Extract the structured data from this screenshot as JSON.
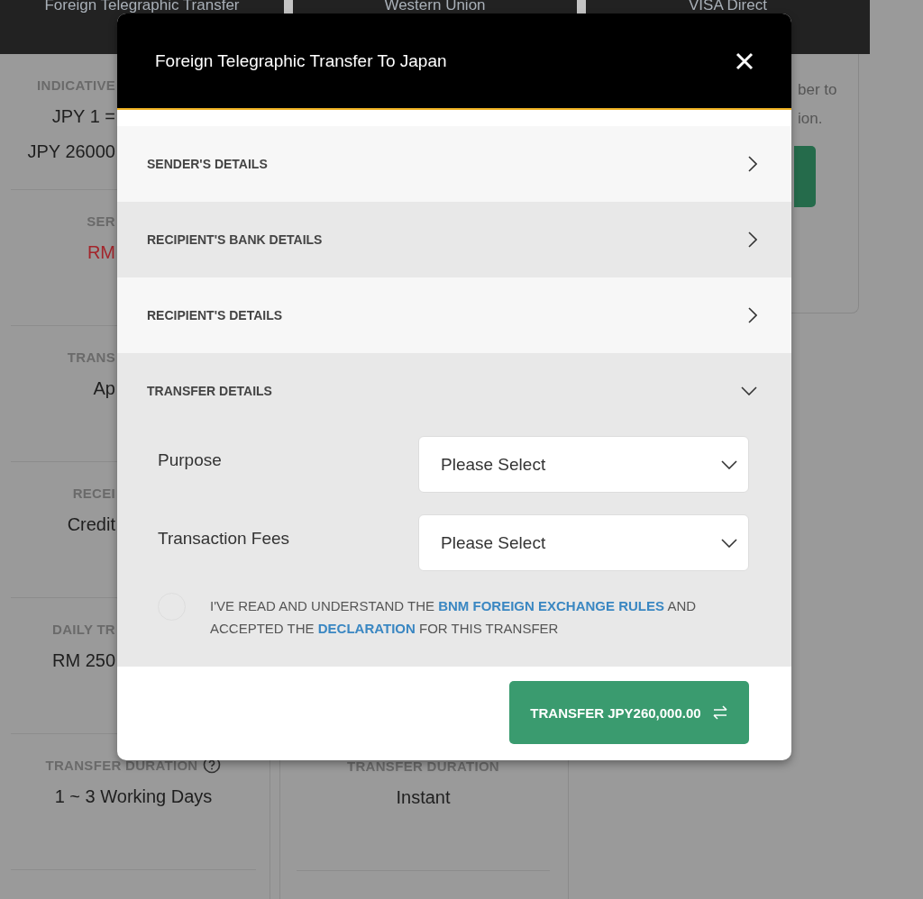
{
  "background_page": {
    "tabs": [
      {
        "label": "Foreign Telegraphic Transfer"
      },
      {
        "label": "Western Union"
      },
      {
        "label": "VISA Direct"
      }
    ],
    "left_column": {
      "sections": [
        {
          "label": "INDICATIVE",
          "values": [
            {
              "text": "JPY 1 =",
              "highlight": false
            },
            {
              "text": "JPY 26000",
              "highlight": false
            }
          ]
        },
        {
          "label": "SER",
          "values": [
            {
              "text": "RM",
              "highlight": true
            }
          ]
        },
        {
          "label": "TRANS",
          "values": [
            {
              "text": "Ap",
              "highlight": false
            }
          ]
        },
        {
          "label": "RECEI",
          "values": [
            {
              "text": "Credit",
              "highlight": false
            }
          ]
        },
        {
          "label": "DAILY TR",
          "values": [
            {
              "text": "RM 250",
              "highlight": false
            }
          ]
        },
        {
          "label": "TRANSFER DURATION",
          "info": true,
          "values": [
            {
              "text": "1 ~ 3 Working Days",
              "highlight": false
            }
          ]
        }
      ]
    },
    "middle_column": {
      "sections": [
        {
          "label": "TRANSFER DURATION",
          "info": false,
          "values": [
            {
              "text": "Instant",
              "highlight": false
            }
          ]
        }
      ]
    },
    "right_column": {
      "notes": [
        "ber to",
        "ion."
      ]
    }
  },
  "dialog": {
    "title": "Foreign Telegraphic Transfer To Japan",
    "sections": [
      {
        "title": "SENDER'S DETAILS",
        "expanded": false
      },
      {
        "title": "RECIPIENT'S BANK DETAILS",
        "expanded": false
      },
      {
        "title": "RECIPIENT'S DETAILS",
        "expanded": false
      },
      {
        "title": "TRANSFER DETAILS",
        "expanded": true,
        "fields": [
          {
            "label": "Purpose",
            "placeholder": "Please Select"
          },
          {
            "label": "Transaction Fees",
            "placeholder": "Please Select"
          }
        ],
        "declaration": {
          "checked": false,
          "parts": [
            {
              "kind": "text",
              "text": "I'VE READ AND UNDERSTAND THE "
            },
            {
              "kind": "link",
              "text": "BNM FOREIGN EXCHANGE RULES"
            },
            {
              "kind": "text",
              "text": " AND ACCEPTED THE "
            },
            {
              "kind": "link",
              "text": "DECLARATION"
            },
            {
              "kind": "text",
              "text": " FOR THIS TRANSFER"
            }
          ]
        }
      }
    ],
    "submit_button": {
      "label": "TRANSFER JPY260,000.00"
    }
  }
}
